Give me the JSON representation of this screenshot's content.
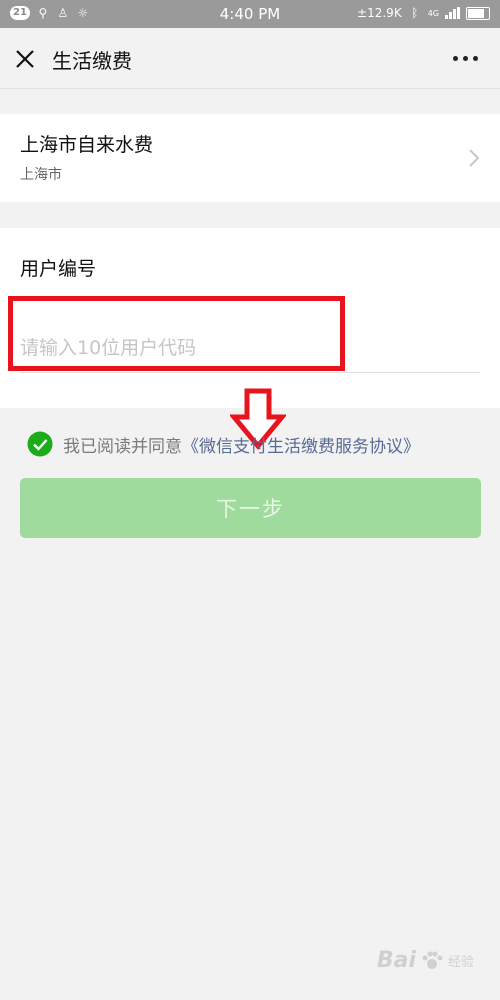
{
  "status_bar": {
    "notification_count": "21",
    "time": "4:40 PM",
    "network_speed": "±12.9K",
    "network_type": "4G",
    "icons": [
      "usb-icon",
      "person-icon",
      "sun-icon",
      "bluetooth-icon",
      "signal-icon",
      "battery-icon"
    ]
  },
  "nav": {
    "title": "生活缴费"
  },
  "organization": {
    "name": "上海市自来水费",
    "city": "上海市"
  },
  "form": {
    "label": "用户编号",
    "placeholder": "请输入10位用户代码",
    "value": ""
  },
  "agreement": {
    "prefix": "我已阅读并同意",
    "link": "《微信支付生活缴费服务协议》",
    "checked": true
  },
  "next_button": {
    "label": "下一步",
    "enabled": false
  },
  "watermark": {
    "text": "Bai",
    "suffix": "经验"
  },
  "colors": {
    "accent_green": "#1aad19",
    "disabled_green": "#9fdb9c",
    "link_blue": "#576b95",
    "annotation_red": "#e8141d"
  }
}
